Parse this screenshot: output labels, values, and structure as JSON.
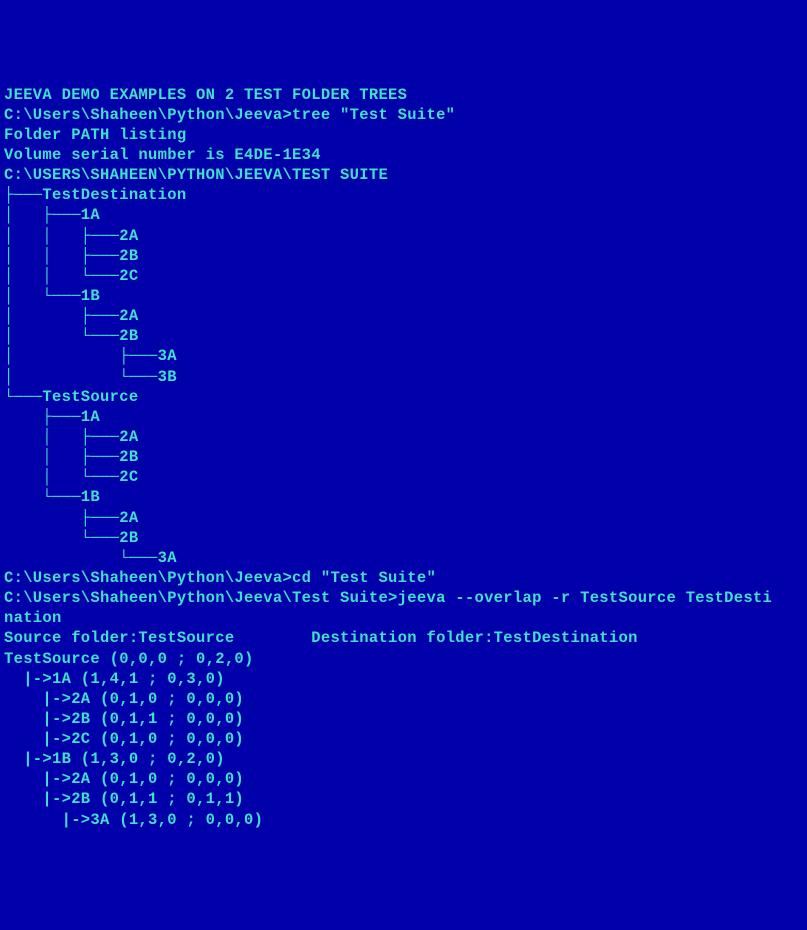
{
  "lines": [
    "JEEVA DEMO EXAMPLES ON 2 TEST FOLDER TREES",
    "",
    "C:\\Users\\Shaheen\\Python\\Jeeva>tree \"Test Suite\"",
    "Folder PATH listing",
    "Volume serial number is E4DE-1E34",
    "C:\\USERS\\SHAHEEN\\PYTHON\\JEEVA\\TEST SUITE",
    "├───TestDestination",
    "│   ├───1A",
    "│   │   ├───2A",
    "│   │   ├───2B",
    "│   │   └───2C",
    "│   └───1B",
    "│       ├───2A",
    "│       └───2B",
    "│           ├───3A",
    "│           └───3B",
    "└───TestSource",
    "    ├───1A",
    "    │   ├───2A",
    "    │   ├───2B",
    "    │   └───2C",
    "    └───1B",
    "        ├───2A",
    "        └───2B",
    "            └───3A",
    "",
    "C:\\Users\\Shaheen\\Python\\Jeeva>cd \"Test Suite\"",
    "",
    "C:\\Users\\Shaheen\\Python\\Jeeva\\Test Suite>jeeva --overlap -r TestSource TestDesti",
    "nation",
    "Source folder:TestSource        Destination folder:TestDestination",
    "TestSource (0,0,0 ; 0,2,0)",
    "  |->1A (1,4,1 ; 0,3,0)",
    "    |->2A (0,1,0 ; 0,0,0)",
    "    |->2B (0,1,1 ; 0,0,0)",
    "    |->2C (0,1,0 ; 0,0,0)",
    "  |->1B (1,3,0 ; 0,2,0)",
    "    |->2A (0,1,0 ; 0,0,0)",
    "    |->2B (0,1,1 ; 0,1,1)",
    "      |->3A (1,3,0 ; 0,0,0)"
  ]
}
